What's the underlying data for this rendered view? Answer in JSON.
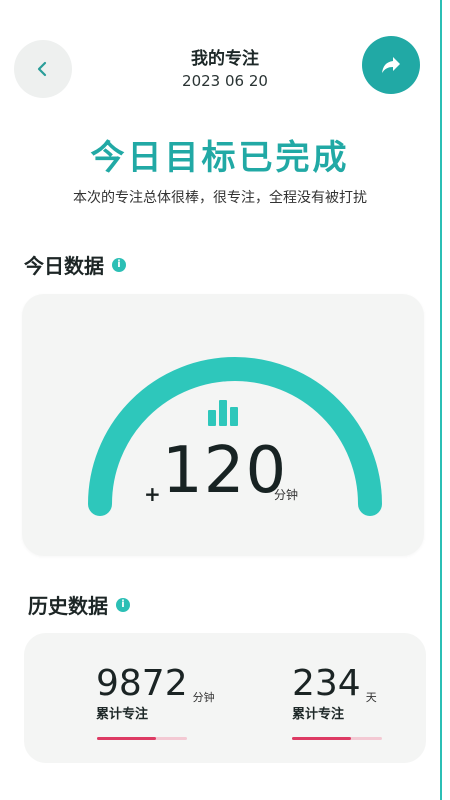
{
  "header": {
    "back_icon": "chevron-left-icon",
    "title": "我的专注",
    "date": "2023 06 20",
    "share_icon": "share-arrow-icon"
  },
  "summary": {
    "goal_title": "今日目标已完成",
    "goal_subtitle": "本次的专注总体很棒，很专注，全程没有被打扰"
  },
  "today": {
    "section_title": "今日数据",
    "info_icon": "info-icon",
    "gauge_icon": "bar-chart-icon",
    "prefix": "+",
    "value": "120",
    "unit": "分钟"
  },
  "history": {
    "section_title": "历史数据",
    "info_icon": "info-icon",
    "stats": [
      {
        "value": "9872",
        "unit": "分钟",
        "label": "累计专注",
        "progress": 0.65
      },
      {
        "value": "234",
        "unit": "天",
        "label": "累计专注",
        "progress": 0.65
      }
    ]
  },
  "colors": {
    "accent": "#21a9a5",
    "gauge_track": "#2ec7bb",
    "progress": "#dd3a63",
    "progress_bg": "#f3c9d3",
    "card_bg": "#f4f5f4"
  }
}
